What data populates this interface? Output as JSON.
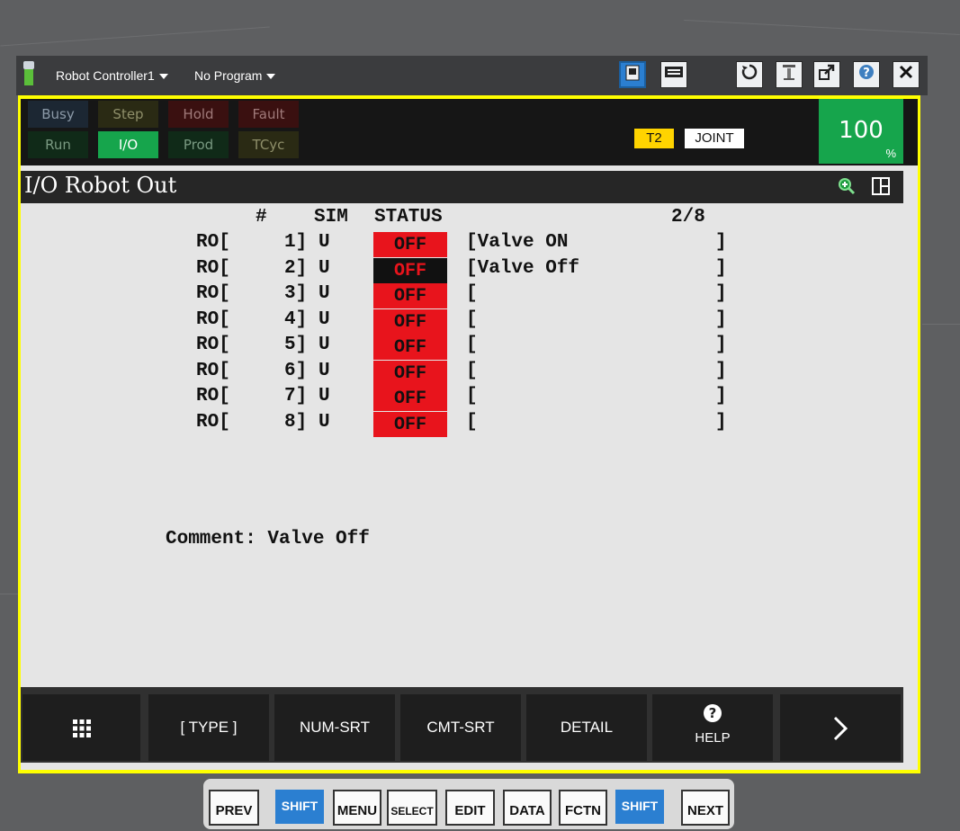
{
  "titlebar": {
    "controller": "Robot Controller1",
    "program": "No Program"
  },
  "status": {
    "row1": [
      {
        "label": "Busy",
        "bg": "#1c2733",
        "fg": "#8c9aa8"
      },
      {
        "label": "Step",
        "bg": "#2a2a14",
        "fg": "#8f8f6a"
      },
      {
        "label": "Hold",
        "bg": "#3a1010",
        "fg": "#a07a7a"
      },
      {
        "label": "Fault",
        "bg": "#3a1010",
        "fg": "#a07a7a"
      }
    ],
    "row2": [
      {
        "label": "Run",
        "bg": "#102a18",
        "fg": "#7a9a82"
      },
      {
        "label": "I/O",
        "bg": "#16a54c",
        "fg": "#ffffff"
      },
      {
        "label": "Prod",
        "bg": "#102a18",
        "fg": "#7a9a82"
      },
      {
        "label": "TCyc",
        "bg": "#2a2a14",
        "fg": "#8f8f6a"
      }
    ],
    "t2": "T2",
    "coord": "JOINT",
    "override": "100",
    "override_unit": "%"
  },
  "screen": {
    "title": "I/O Robot Out",
    "header": {
      "num": "#",
      "sim": "SIM",
      "status": "STATUS",
      "page": "2/8"
    },
    "rows": [
      {
        "type": "RO[",
        "num": "1]",
        "sim": "U",
        "status": "OFF",
        "comment": "[Valve ON",
        "end": "]"
      },
      {
        "type": "RO[",
        "num": "2]",
        "sim": "U",
        "status": "OFF",
        "comment": "[Valve Off",
        "end": "]"
      },
      {
        "type": "RO[",
        "num": "3]",
        "sim": "U",
        "status": "OFF",
        "comment": "[",
        "end": "]"
      },
      {
        "type": "RO[",
        "num": "4]",
        "sim": "U",
        "status": "OFF",
        "comment": "[",
        "end": "]"
      },
      {
        "type": "RO[",
        "num": "5]",
        "sim": "U",
        "status": "OFF",
        "comment": "[",
        "end": "]"
      },
      {
        "type": "RO[",
        "num": "6]",
        "sim": "U",
        "status": "OFF",
        "comment": "[",
        "end": "]"
      },
      {
        "type": "RO[",
        "num": "7]",
        "sim": "U",
        "status": "OFF",
        "comment": "[",
        "end": "]"
      },
      {
        "type": "RO[",
        "num": "8]",
        "sim": "U",
        "status": "OFF",
        "comment": "[",
        "end": "]"
      }
    ],
    "comment_line": "Comment: Valve Off"
  },
  "function_keys": {
    "type": "[ TYPE ]",
    "num_srt": "NUM-SRT",
    "cmt_srt": "CMT-SRT",
    "detail": "DETAIL",
    "help": "HELP"
  },
  "hard_keys": [
    "PREV",
    "SHIFT",
    "MENU",
    "SELECT",
    "EDIT",
    "DATA",
    "FCTN",
    "SHIFT",
    "NEXT"
  ],
  "colors": {
    "frame": "#ffff00",
    "status_off": "#e8141c",
    "accent_blue": "#2b7fd1",
    "green": "#16a54c"
  }
}
